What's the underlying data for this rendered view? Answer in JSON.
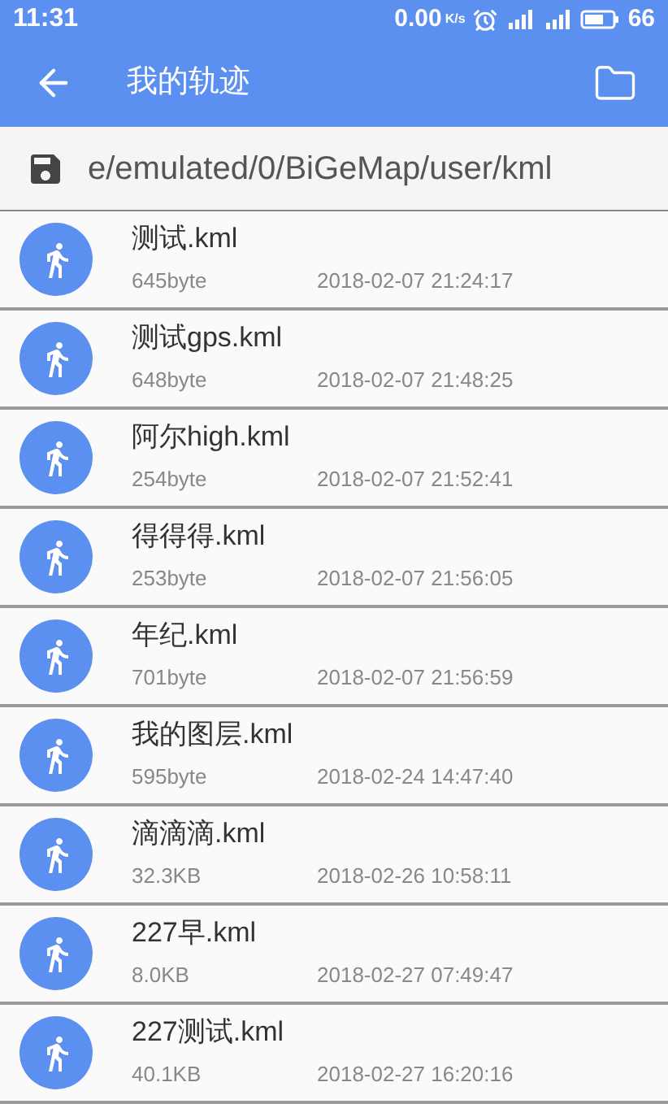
{
  "status_bar": {
    "time": "11:31",
    "speed": "0.00",
    "speed_unit": "K/s",
    "battery": "66"
  },
  "app_bar": {
    "title": "我的轨迹"
  },
  "path_bar": {
    "path": "e/emulated/0/BiGeMap/user/kml"
  },
  "files": [
    {
      "name": "测试.kml",
      "size": "645byte",
      "date": "2018-02-07 21:24:17"
    },
    {
      "name": "测试gps.kml",
      "size": "648byte",
      "date": "2018-02-07 21:48:25"
    },
    {
      "name": "阿尔high.kml",
      "size": "254byte",
      "date": "2018-02-07 21:52:41"
    },
    {
      "name": "得得得.kml",
      "size": "253byte",
      "date": "2018-02-07 21:56:05"
    },
    {
      "name": "年纪.kml",
      "size": "701byte",
      "date": "2018-02-07 21:56:59"
    },
    {
      "name": "我的图层.kml",
      "size": "595byte",
      "date": "2018-02-24 14:47:40"
    },
    {
      "name": "滴滴滴.kml",
      "size": "32.3KB",
      "date": "2018-02-26 10:58:11"
    },
    {
      "name": "227早.kml",
      "size": "8.0KB",
      "date": "2018-02-27 07:49:47"
    },
    {
      "name": "227测试.kml",
      "size": "40.1KB",
      "date": "2018-02-27 16:20:16"
    }
  ]
}
